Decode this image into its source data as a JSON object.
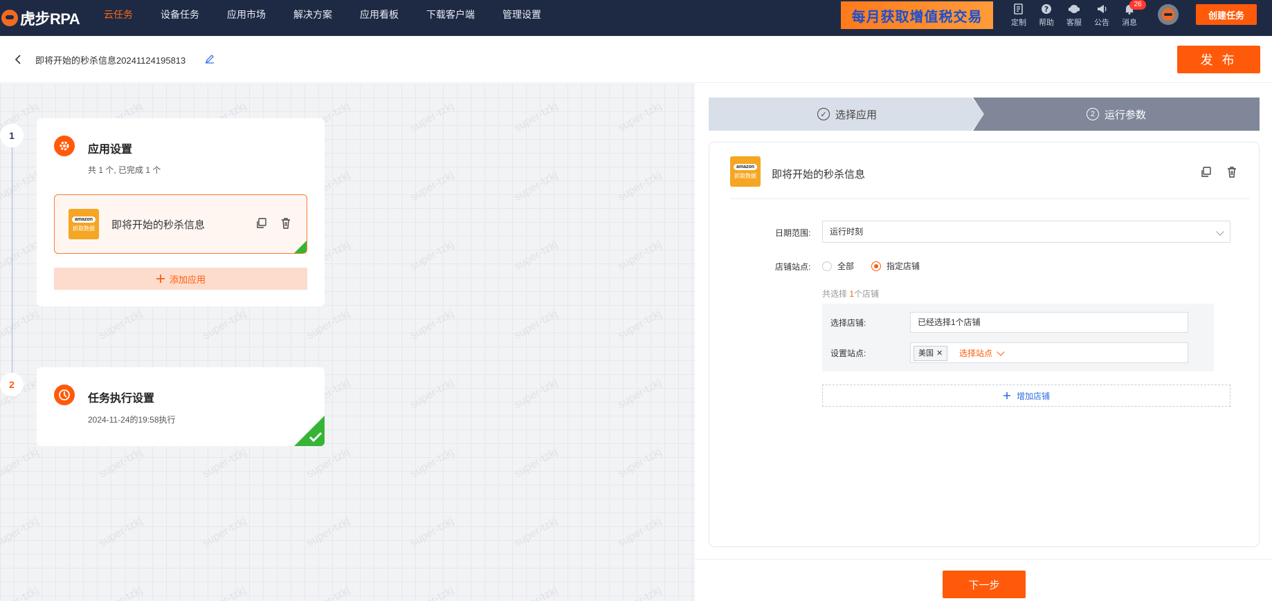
{
  "brand": {
    "name": "虎步RPA"
  },
  "nav": [
    {
      "label": "云任务",
      "active": true
    },
    {
      "label": "设备任务"
    },
    {
      "label": "应用市场"
    },
    {
      "label": "解决方案"
    },
    {
      "label": "应用看板"
    },
    {
      "label": "下载客户端"
    },
    {
      "label": "管理设置"
    }
  ],
  "promo": {
    "text": "每月获取增值税交易"
  },
  "tools": [
    {
      "label": "定制",
      "icon": "customize-icon"
    },
    {
      "label": "帮助",
      "icon": "help-icon"
    },
    {
      "label": "客服",
      "icon": "support-icon"
    },
    {
      "label": "公告",
      "icon": "announcement-icon"
    },
    {
      "label": "消息",
      "icon": "bell-icon",
      "badge": "26"
    }
  ],
  "header": {
    "create_label": "创建任务"
  },
  "task": {
    "title": "即将开始的秒杀信息20241124195813",
    "publish_label": "发 布"
  },
  "watermark": "super-tzkj",
  "steps_left": [
    {
      "num": "1",
      "title": "应用设置",
      "sub": "共 1 个, 已完成 1 个",
      "app_name": "即将开始的秒杀信息",
      "add_label": "添加应用",
      "app_logo_text": "amazon",
      "app_logo_caption": "抓取数据"
    },
    {
      "num": "2",
      "title": "任务执行设置",
      "sub": "2024-11-24的19:58执行"
    }
  ],
  "wizard": {
    "step1": "选择应用",
    "step2_num": "2",
    "step2": "运行参数"
  },
  "form": {
    "app_name": "即将开始的秒杀信息",
    "date_label": "日期范围:",
    "date_value": "运行时刻",
    "store_label": "店铺站点:",
    "radio_all": "全部",
    "radio_specific": "指定店铺",
    "selected_prefix": "共选择",
    "selected_count": "1",
    "selected_suffix": "个店铺",
    "choose_store_label": "选择店铺:",
    "choose_store_value": "已经选择1个店铺",
    "site_label": "设置站点:",
    "site_tag": "美国",
    "pick_site": "选择站点",
    "add_store": "增加店铺"
  },
  "next_label": "下一步",
  "colors": {
    "accent": "#ff5a0a",
    "topbar": "#1e2a44",
    "success": "#35b535",
    "link": "#2e6be6"
  }
}
